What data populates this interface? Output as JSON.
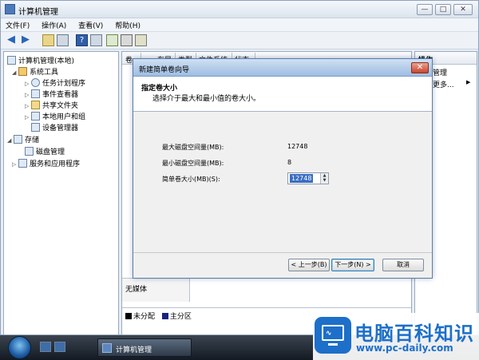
{
  "window": {
    "title": "计算机管理"
  },
  "menubar": [
    "文件(F)",
    "操作(A)",
    "查看(V)",
    "帮助(H)"
  ],
  "tree": {
    "root": "计算机管理(本地)",
    "system_tools": "系统工具",
    "task_scheduler": "任务计划程序",
    "event_viewer": "事件查看器",
    "shared_folders": "共享文件夹",
    "local_users": "本地用户和组",
    "device_manager": "设备管理器",
    "storage": "存储",
    "disk_management": "磁盘管理",
    "services_apps": "服务和应用程序"
  },
  "columns": [
    "卷",
    "布局",
    "类型",
    "文件系统",
    "状态"
  ],
  "disk_panel": {
    "no_media": "无媒体"
  },
  "legend": {
    "unallocated": "未分配",
    "primary": "主分区"
  },
  "actions": {
    "header": "操作",
    "item1": "管理",
    "item2": "更多..."
  },
  "colors": {
    "unallocated": "#000000",
    "primary": "#1a237e"
  },
  "wizard": {
    "title": "新建简单卷向导",
    "heading": "指定卷大小",
    "subheading": "选择介于最大和最小值的卷大小。",
    "max_label": "最大磁盘空间量(MB):",
    "max_value": "12748",
    "min_label": "最小磁盘空间量(MB):",
    "min_value": "8",
    "size_label": "简单卷大小(MB)(S):",
    "size_value": "12748",
    "back": "< 上一步(B)",
    "next": "下一步(N) >",
    "cancel": "取消"
  },
  "taskbar": {
    "task_label": "计算机管理"
  },
  "watermark": {
    "name": "电脑百科知识",
    "url": "www.pc-daily.com"
  }
}
